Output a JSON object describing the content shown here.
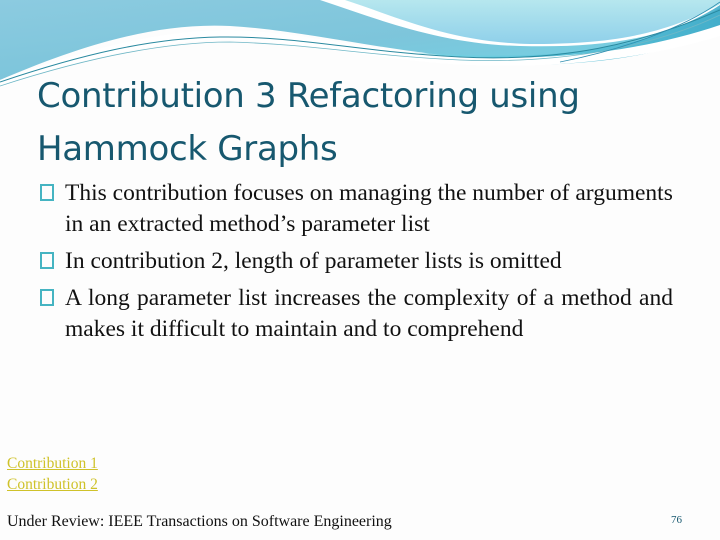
{
  "slide": {
    "title": "Contribution 3 Refactoring using Hammock Graphs",
    "bullets": [
      {
        "icon": "square-bullet-icon",
        "text": "This contribution focuses on managing the number of arguments in an extracted method’s parameter list"
      },
      {
        "icon": "square-bullet-icon",
        "text": "In contribution 2, length of parameter lists is omitted"
      },
      {
        "icon": "square-bullet-icon",
        "text": "A long parameter list increases the complexity of a method and makes it difficult to maintain and to comprehend"
      }
    ],
    "links": [
      {
        "label": "Contribution 1"
      },
      {
        "label": "Contribution 2"
      }
    ],
    "footer": "Under Review: IEEE Transactions on Software Engineering",
    "page_number": "76"
  },
  "colors": {
    "title": "#17586f",
    "bullet_box": "#45b4c2",
    "link": "#cfc22a",
    "wave_light": "#a9e0ea",
    "wave_mid": "#7cc8dc",
    "wave_dark": "#2f9fb5"
  }
}
